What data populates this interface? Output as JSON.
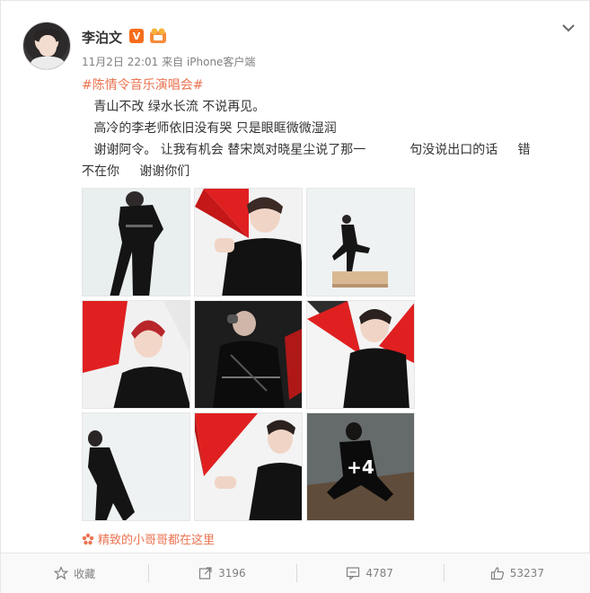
{
  "post": {
    "username": "李泊文",
    "verified_badge": "V",
    "meta": "11月2日 22:01 来自 iPhone客户端",
    "hashtag": "#陈情令音乐演唱会#",
    "lines": [
      "   青山不改 绿水长流 不说再见。",
      "   高冷的李老师依旧没有哭 只是眼眶微微湿润",
      "   谢谢阿令。 让我有机会 替宋岚对晓星尘说了那一           句没说出口的话     错",
      "不在你     谢谢你们"
    ],
    "more_count": "+4",
    "bottom_link": "精致的小哥哥都在这里"
  },
  "actions": {
    "favorite_label": "收藏",
    "repost_count": "3196",
    "comment_count": "4787",
    "like_count": "53237"
  },
  "colors": {
    "accent": "#eb7350",
    "verified": "#f76d1b",
    "fan_red": "#e02020"
  },
  "icons": [
    "chevron-down-icon",
    "star-icon",
    "share-icon",
    "comment-icon",
    "thumbs-up-icon",
    "flower-icon"
  ]
}
